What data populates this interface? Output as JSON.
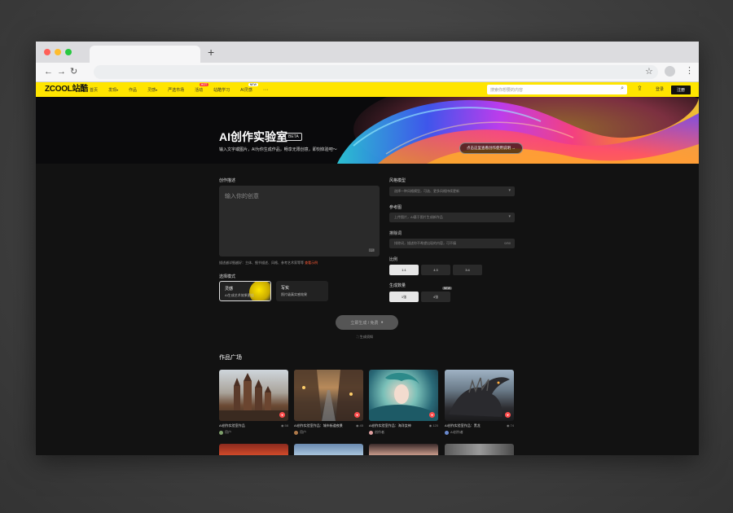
{
  "site": {
    "logo": "ZCOOL站酷",
    "nav": [
      {
        "label": "首页"
      },
      {
        "label": "发现",
        "badge": ""
      },
      {
        "label": "作品"
      },
      {
        "label": "灵感"
      },
      {
        "label": "严选市场"
      },
      {
        "label": "活动",
        "badge": "HOT"
      },
      {
        "label": "站酷学习"
      },
      {
        "label": "AI灵感",
        "badge": "NEW"
      }
    ],
    "nav_more": "···",
    "search_placeholder": "搜索你想要的内容",
    "login": "登录",
    "register": "注册"
  },
  "banner": {
    "title": "AI创作实验室",
    "beta": "BETA",
    "subtitle": "输入文字或图片，AI为你生成作品，畅享无限创意，即刻体验吧～",
    "cta": "点击这里查看创作使用说明 →"
  },
  "form": {
    "prompt_label": "创作描述",
    "prompt_placeholder": "输入你的创意",
    "prompt_hint": "描述越详细越好：主体、细节描述、风格、参考艺术家等等",
    "prompt_hint_link": "查看示例",
    "mode_label": "选择模式",
    "modes": [
      {
        "name": "灵感",
        "desc": "AI生成艺术效果更佳"
      },
      {
        "name": "写实",
        "desc": "照片级真实感效果"
      }
    ],
    "style_label": "风格模型",
    "style_placeholder": "选择一种风格模型，可选、更多风格持续更新",
    "reference_label": "参考图",
    "reference_placeholder": "上传图片，AI基于图片生成新作品",
    "negative_label": "排除词",
    "negative_placeholder": "排除词，描述你不希望出现的内容，可不填",
    "negative_count": "0/50",
    "ratio_label": "比例",
    "ratios": [
      "1:1",
      "4:3",
      "3:4"
    ],
    "count_label": "生成数量",
    "counts": [
      "1张",
      "4张"
    ],
    "count_badge": "NEW",
    "generate_button": "立即生成 / 免费",
    "generate_note": "生成须知"
  },
  "gallery": {
    "title": "作品广场",
    "cards": [
      {
        "title": "AI创作实验室作品",
        "views": "58",
        "author": "用户"
      },
      {
        "title": "AI创作实验室作品：城市街道夜景",
        "views": "45",
        "author": "用户"
      },
      {
        "title": "AI创作实验室作品：海洋女神",
        "views": "120",
        "author": "创作者"
      },
      {
        "title": "AI创作实验室作品：黑龙",
        "views": "74",
        "author": "AI创作者"
      }
    ]
  },
  "colors": {
    "brand": "#ffe500",
    "accent_link": "#ff5a36",
    "background": "#121212"
  }
}
